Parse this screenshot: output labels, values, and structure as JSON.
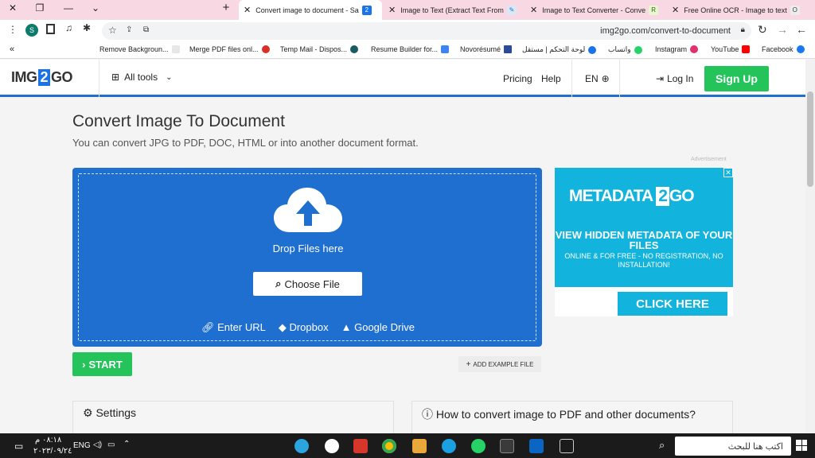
{
  "browser": {
    "tabs": [
      {
        "title": "Convert image to document - Sa"
      },
      {
        "title": "Image to Text (Extract Text From"
      },
      {
        "title": "Image to Text Converter - Conve"
      },
      {
        "title": "Free Online OCR - Image to text"
      }
    ],
    "url": "img2go.com/convert-to-document",
    "bookmarks": [
      {
        "label": "Remove Backgroun..."
      },
      {
        "label": "Merge PDF files onl..."
      },
      {
        "label": "Temp Mail - Dispos..."
      },
      {
        "label": "Resume Builder for..."
      },
      {
        "label": "Novorésumé"
      },
      {
        "label": "لوحة التحكم | مستقل"
      },
      {
        "label": "واتساب"
      },
      {
        "label": "Instagram"
      },
      {
        "label": "YouTube"
      },
      {
        "label": "Facebook"
      }
    ]
  },
  "site": {
    "logo": {
      "prefix": "IMG",
      "mid": "2",
      "suffix": "GO"
    },
    "all_tools": "All tools",
    "pricing": "Pricing",
    "help": "Help",
    "lang": "EN",
    "login": "Log In",
    "signup": "Sign Up"
  },
  "main": {
    "title": "Convert Image To Document",
    "subtitle": "You can convert JPG to PDF, DOC, HTML or into another document format.",
    "drop_text": "Drop Files here",
    "choose_file": "Choose File",
    "enter_url": "Enter URL",
    "dropbox": "Dropbox",
    "google_drive": "Google Drive",
    "start": "START",
    "add_example": "ADD EXAMPLE FILE",
    "settings": "Settings",
    "howto": "How to convert image to PDF and other documents?"
  },
  "ad": {
    "label": "Advertisement",
    "brand_left": "METADATA",
    "brand_mid": "2",
    "brand_right": "GO",
    "headline": "VIEW HIDDEN METADATA OF YOUR FILES",
    "small": "ONLINE & FOR FREE - NO REGISTRATION, NO INSTALLATION!",
    "cta": "CLICK HERE"
  },
  "taskbar": {
    "time": "٠٨:١٨ م",
    "date": "٢٠٢٣/٠٩/٢٤",
    "lang": "ENG",
    "search": "اكتب هنا للبحث"
  },
  "colors": {
    "accent": "#1f6fd0",
    "green": "#24c45b",
    "ad_blue": "#12b3dc"
  }
}
